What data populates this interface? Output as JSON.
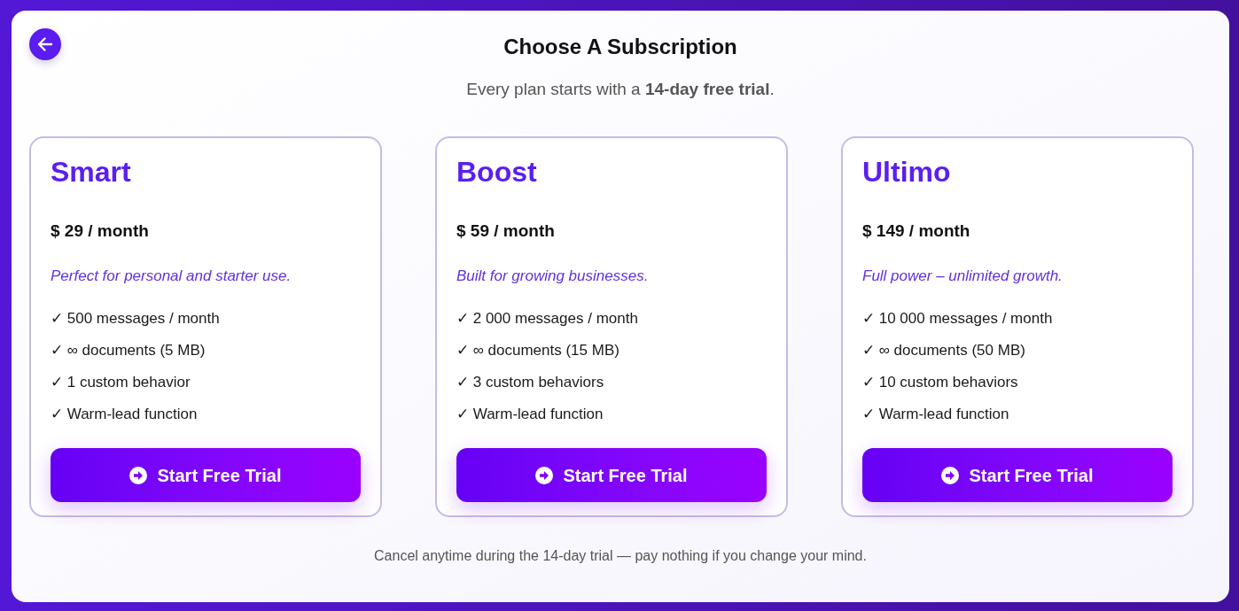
{
  "header": {
    "title": "Choose A Subscription",
    "subtitle": "Every plan starts with a **14-day free trial**."
  },
  "plans": [
    {
      "name": "Smart",
      "price": "$ 29 / month",
      "tagline": "Perfect for personal and starter use.",
      "features": [
        "✓ 500 messages / month",
        "✓ ∞ documents (5 MB)",
        "✓ 1 custom behavior",
        "✓ Warm-lead function"
      ],
      "button": "Start Free Trial"
    },
    {
      "name": "Boost",
      "price": "$ 59 / month",
      "tagline": "Built for growing businesses.",
      "features": [
        "✓ 2 000 messages / month",
        "✓ ∞ documents (15 MB)",
        "✓ 3 custom behaviors",
        "✓ Warm-lead function"
      ],
      "button": "Start Free Trial"
    },
    {
      "name": "Ultimo",
      "price": "$ 149 / month",
      "tagline": "Full power – unlimited growth.",
      "features": [
        "✓ 10 000 messages / month",
        "✓ ∞ documents (50 MB)",
        "✓ 10 custom behaviors",
        "✓ Warm-lead function"
      ],
      "button": "Start Free Trial"
    }
  ],
  "footer": {
    "note": "Cancel anytime during the 14-day trial — pay nothing if you change your mind."
  }
}
